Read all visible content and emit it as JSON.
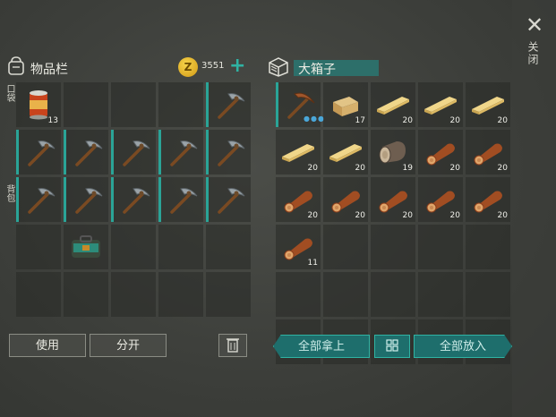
{
  "inventory": {
    "title": "物品栏",
    "coins": "3551",
    "pocket_label": "口袋",
    "backpack_label": "背包",
    "use_label": "使用",
    "split_label": "分开",
    "slots": [
      {
        "item": "can",
        "qty": "13"
      },
      {
        "item": "empty"
      },
      {
        "item": "empty"
      },
      {
        "item": "empty"
      },
      {
        "item": "pickaxe",
        "accent": true
      },
      {
        "item": "pickaxe",
        "accent": true
      },
      {
        "item": "pickaxe",
        "accent": true
      },
      {
        "item": "pickaxe",
        "accent": true
      },
      {
        "item": "pickaxe",
        "accent": true
      },
      {
        "item": "pickaxe",
        "accent": true
      },
      {
        "item": "pickaxe",
        "accent": true
      },
      {
        "item": "pickaxe",
        "accent": true
      },
      {
        "item": "pickaxe",
        "accent": true
      },
      {
        "item": "pickaxe",
        "accent": true
      },
      {
        "item": "pickaxe",
        "accent": true
      },
      {
        "item": "empty"
      },
      {
        "item": "bag"
      },
      {
        "item": "empty"
      },
      {
        "item": "empty"
      },
      {
        "item": "empty"
      },
      {
        "item": "empty"
      },
      {
        "item": "empty"
      },
      {
        "item": "empty"
      },
      {
        "item": "empty"
      },
      {
        "item": "empty"
      }
    ]
  },
  "chest": {
    "title": "大箱子",
    "take_all": "全部拿上",
    "put_all": "全部放入",
    "slots": [
      {
        "item": "pickaxe-copper",
        "accent": true,
        "dots": "●●●"
      },
      {
        "item": "wood-block",
        "qty": "17"
      },
      {
        "item": "plank",
        "qty": "20"
      },
      {
        "item": "plank",
        "qty": "20"
      },
      {
        "item": "plank",
        "qty": "20"
      },
      {
        "item": "plank",
        "qty": "20"
      },
      {
        "item": "plank",
        "qty": "20"
      },
      {
        "item": "log-grey",
        "qty": "19"
      },
      {
        "item": "log",
        "qty": "20"
      },
      {
        "item": "log",
        "qty": "20"
      },
      {
        "item": "log",
        "qty": "20"
      },
      {
        "item": "log",
        "qty": "20"
      },
      {
        "item": "log",
        "qty": "20"
      },
      {
        "item": "log",
        "qty": "20"
      },
      {
        "item": "log",
        "qty": "20"
      },
      {
        "item": "log",
        "qty": "11"
      },
      {
        "item": "empty"
      },
      {
        "item": "empty"
      },
      {
        "item": "empty"
      },
      {
        "item": "empty"
      },
      {
        "item": "empty"
      },
      {
        "item": "empty"
      },
      {
        "item": "empty"
      },
      {
        "item": "empty"
      },
      {
        "item": "empty"
      },
      {
        "item": "empty"
      },
      {
        "item": "empty"
      },
      {
        "item": "empty"
      },
      {
        "item": "empty"
      },
      {
        "item": "empty"
      }
    ]
  },
  "close_label": "关闭",
  "colors": {
    "accent": "#2aa497",
    "teal_button": "#1e6e6c",
    "coin": "#f0c53b"
  },
  "icons": [
    "backpack-icon",
    "coin-icon",
    "plus-icon",
    "chest-icon",
    "close-icon",
    "trash-icon",
    "sort-icon"
  ]
}
